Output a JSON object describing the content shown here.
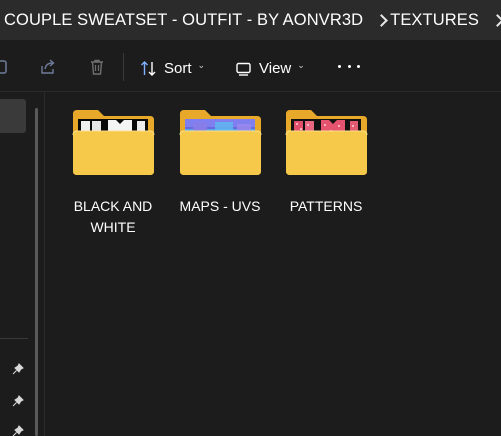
{
  "breadcrumb": {
    "items": [
      "COUPLE SWEATSET - OUTFIT - BY AONVR3D",
      "TEXTURES"
    ]
  },
  "toolbar": {
    "sort_label": "Sort",
    "view_label": "View",
    "icons": [
      "share-icon",
      "delete-icon",
      "sort-icon",
      "view-icon",
      "more-icon"
    ]
  },
  "folders": [
    {
      "name": "BLACK AND WHITE",
      "thumbnail": "black-and-white-texture"
    },
    {
      "name": "MAPS - UVS",
      "thumbnail": "uv-map-texture"
    },
    {
      "name": "PATTERNS",
      "thumbnail": "pattern-texture"
    }
  ],
  "colors": {
    "folder_front": "#f6c94b",
    "folder_back": "#e8a92a",
    "background": "#1c1c1c",
    "address_bar": "#2b2b2b"
  }
}
